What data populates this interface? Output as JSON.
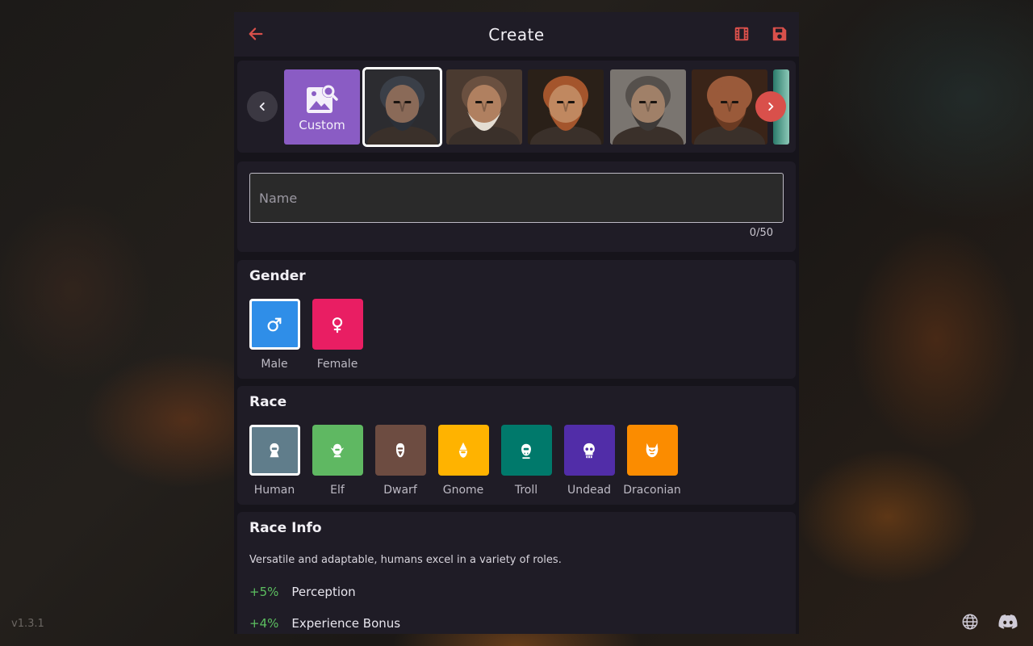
{
  "header": {
    "title": "Create"
  },
  "portraits": {
    "custom_label": "Custom",
    "items": [
      {
        "name": "portrait-1",
        "skin": "#8a6a58",
        "hair": "#3a3f48",
        "beard": "#2c3038",
        "bg": "#2c2c30"
      },
      {
        "name": "portrait-2",
        "skin": "#b08060",
        "hair": "#6a5040",
        "beard": "#e4ddd2",
        "bg": "#4a3a30"
      },
      {
        "name": "portrait-3",
        "skin": "#c08860",
        "hair": "#a4552c",
        "beard": "#a4552c",
        "bg": "#2a2018"
      },
      {
        "name": "portrait-4",
        "skin": "#a08068",
        "hair": "#55504c",
        "beard": "#3e3a38",
        "bg": "#7a7570"
      },
      {
        "name": "portrait-5",
        "skin": "#9a5a3a",
        "hair": "#9a5a3a",
        "beard": "#6a3a22",
        "bg": "#3a2418"
      }
    ]
  },
  "name_field": {
    "placeholder": "Name",
    "value": "",
    "counter": "0/50"
  },
  "gender": {
    "title": "Gender",
    "options": [
      {
        "label": "Male",
        "color": "#2f8ee8",
        "icon": "male-icon",
        "selected": true
      },
      {
        "label": "Female",
        "color": "#e91e63",
        "icon": "female-icon",
        "selected": false
      }
    ]
  },
  "race": {
    "title": "Race",
    "options": [
      {
        "label": "Human",
        "color": "#607d8b",
        "icon": "human-icon",
        "selected": true
      },
      {
        "label": "Elf",
        "color": "#5fb862",
        "icon": "elf-icon",
        "selected": false
      },
      {
        "label": "Dwarf",
        "color": "#6d4c41",
        "icon": "dwarf-icon",
        "selected": false
      },
      {
        "label": "Gnome",
        "color": "#ffb300",
        "icon": "gnome-icon",
        "selected": false
      },
      {
        "label": "Troll",
        "color": "#00796b",
        "icon": "troll-icon",
        "selected": false
      },
      {
        "label": "Undead",
        "color": "#512da8",
        "icon": "undead-icon",
        "selected": false
      },
      {
        "label": "Draconian",
        "color": "#fb8c00",
        "icon": "draconian-icon",
        "selected": false
      }
    ]
  },
  "race_info": {
    "title": "Race Info",
    "description": "Versatile and adaptable, humans excel in a variety of roles.",
    "bonuses": [
      {
        "pct": "+5%",
        "name": "Perception"
      },
      {
        "pct": "+4%",
        "name": "Experience Bonus"
      }
    ]
  },
  "footer": {
    "version": "v1.3.1"
  },
  "colors": {
    "accent": "#d9504b",
    "panel": "#1f1c26",
    "background": "#16141b"
  }
}
